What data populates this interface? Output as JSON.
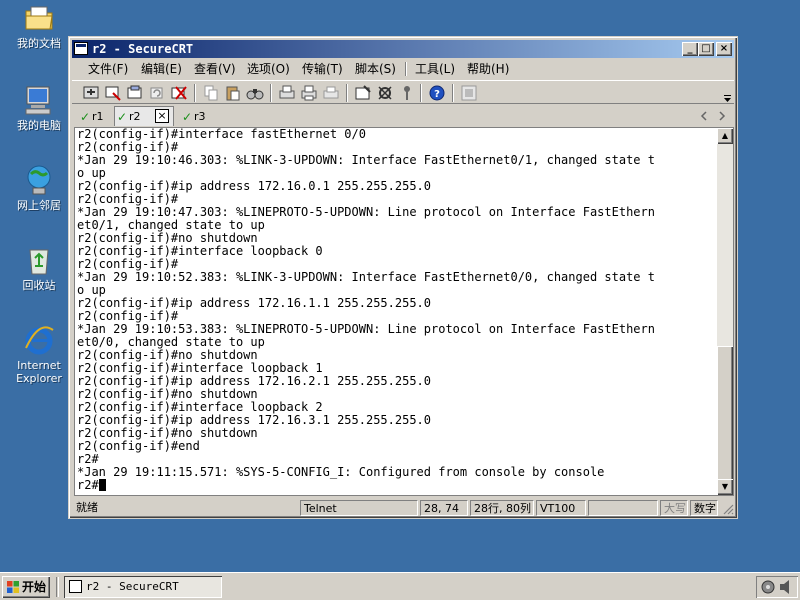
{
  "desktop": {
    "icons": [
      {
        "label": "我的文档"
      },
      {
        "label": "我的电脑"
      },
      {
        "label": "网上邻居"
      },
      {
        "label": "回收站"
      },
      {
        "label_line1": "Internet",
        "label_line2": "Explorer"
      }
    ]
  },
  "window": {
    "title": "r2 - SecureCRT",
    "controls": {
      "minimize": "_",
      "maximize": "□",
      "close": "×"
    }
  },
  "menu": [
    "文件(F)",
    "编辑(E)",
    "查看(V)",
    "选项(O)",
    "传输(T)",
    "脚本(S)",
    "工具(L)",
    "帮助(H)"
  ],
  "tabs": [
    {
      "label": "r1"
    },
    {
      "label": "r2"
    },
    {
      "label": "r3"
    }
  ],
  "terminal": {
    "lines": [
      "r2(config-if)#interface fastEthernet 0/0",
      "r2(config-if)#",
      "*Jan 29 19:10:46.303: %LINK-3-UPDOWN: Interface FastEthernet0/1, changed state t",
      "o up",
      "r2(config-if)#ip address 172.16.0.1 255.255.255.0",
      "r2(config-if)#",
      "*Jan 29 19:10:47.303: %LINEPROTO-5-UPDOWN: Line protocol on Interface FastEthern",
      "et0/1, changed state to up",
      "r2(config-if)#no shutdown",
      "r2(config-if)#interface loopback 0",
      "r2(config-if)#",
      "*Jan 29 19:10:52.383: %LINK-3-UPDOWN: Interface FastEthernet0/0, changed state t",
      "o up",
      "r2(config-if)#ip address 172.16.1.1 255.255.255.0",
      "r2(config-if)#",
      "*Jan 29 19:10:53.383: %LINEPROTO-5-UPDOWN: Line protocol on Interface FastEthern",
      "et0/0, changed state to up",
      "r2(config-if)#no shutdown",
      "r2(config-if)#interface loopback 1",
      "r2(config-if)#ip address 172.16.2.1 255.255.255.0",
      "r2(config-if)#no shutdown",
      "r2(config-if)#interface loopback 2",
      "r2(config-if)#ip address 172.16.3.1 255.255.255.0",
      "r2(config-if)#no shutdown",
      "r2(config-if)#end",
      "r2#",
      "*Jan 29 19:11:15.571: %SYS-5-CONFIG_I: Configured from console by console"
    ],
    "prompt": "r2#"
  },
  "status": {
    "ready": "就绪",
    "protocol": "Telnet",
    "cursor_pos": "28, 74",
    "dimensions": "28行, 80列",
    "emulation": "VT100",
    "caps": "大写",
    "num": "数字"
  },
  "taskbar": {
    "start": "开始",
    "task": "r2 - SecureCRT"
  }
}
